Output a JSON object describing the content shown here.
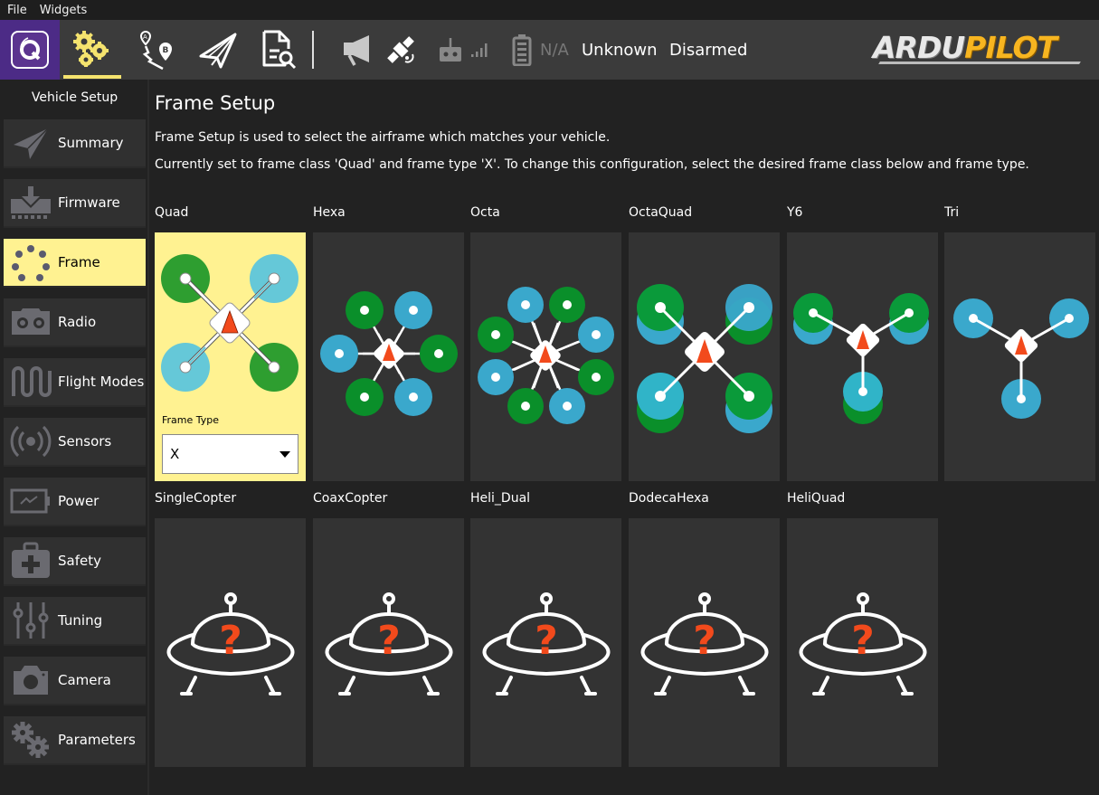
{
  "menubar": {
    "items": [
      "File",
      "Widgets"
    ]
  },
  "toolbar": {
    "buttons": [
      {
        "name": "qgc-logo",
        "icon": "qgroundcontrol-icon"
      },
      {
        "name": "vehicle-setup",
        "icon": "gears-icon",
        "active": true
      },
      {
        "name": "plan",
        "icon": "route-ab-icon"
      },
      {
        "name": "fly",
        "icon": "paper-plane-icon"
      },
      {
        "name": "analyze",
        "icon": "document-search-icon"
      }
    ],
    "status": {
      "messages_icon": "megaphone-icon",
      "gps_icon": "satellite-icon",
      "rc_icon": "rc-transmitter-icon",
      "signal_icon": "signal-bars-icon",
      "battery_icon": "battery-icon",
      "battery_value": "N/A",
      "flight_mode": "Unknown",
      "arm_state": "Disarmed"
    },
    "brand": {
      "part1": "ARDU",
      "part2": "PILOT"
    }
  },
  "sidebar": {
    "title": "Vehicle Setup",
    "items": [
      {
        "label": "Summary",
        "icon": "paper-plane-icon"
      },
      {
        "label": "Firmware",
        "icon": "download-icon"
      },
      {
        "label": "Frame",
        "icon": "frame-dots-icon",
        "active": true
      },
      {
        "label": "Radio",
        "icon": "radio-icon"
      },
      {
        "label": "Flight Modes",
        "icon": "wave-icon"
      },
      {
        "label": "Sensors",
        "icon": "sensors-icon"
      },
      {
        "label": "Power",
        "icon": "battery-icon"
      },
      {
        "label": "Safety",
        "icon": "first-aid-icon"
      },
      {
        "label": "Tuning",
        "icon": "sliders-icon"
      },
      {
        "label": "Camera",
        "icon": "camera-icon"
      },
      {
        "label": "Parameters",
        "icon": "gears-icon"
      }
    ]
  },
  "main": {
    "title": "Frame Setup",
    "description": "Frame Setup is used to select the airframe which matches your vehicle.",
    "current": "Currently set to frame class 'Quad' and frame type 'X'. To change this configuration, select the desired frame class below and frame type.",
    "frame_type_label": "Frame Type",
    "frame_type_value": "X",
    "frames": [
      {
        "label": "Quad",
        "image": "quad",
        "selected": true
      },
      {
        "label": "Hexa",
        "image": "hexa"
      },
      {
        "label": "Octa",
        "image": "octa"
      },
      {
        "label": "OctaQuad",
        "image": "octaquad"
      },
      {
        "label": "Y6",
        "image": "y6"
      },
      {
        "label": "Tri",
        "image": "tri"
      },
      {
        "label": "SingleCopter",
        "image": "unknown-ufo"
      },
      {
        "label": "CoaxCopter",
        "image": "unknown-ufo"
      },
      {
        "label": "Heli_Dual",
        "image": "unknown-ufo"
      },
      {
        "label": "DodecaHexa",
        "image": "unknown-ufo"
      },
      {
        "label": "HeliQuad",
        "image": "unknown-ufo"
      }
    ]
  },
  "colors": {
    "accent": "#fff291",
    "toolbar_logo_bg": "#4c2b86",
    "motor_cw": "#0a8f2a",
    "motor_ccw": "#3aa8cc",
    "heading_arrow": "#f24a1c",
    "unknown_mark": "#f24a1c"
  }
}
